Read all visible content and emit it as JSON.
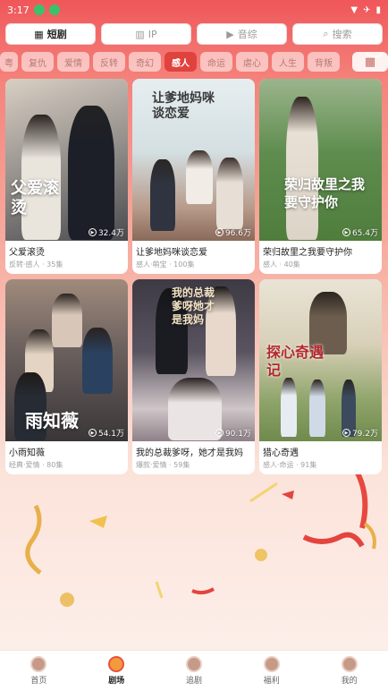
{
  "status_bar": {
    "time": "3:17"
  },
  "top_tabs": [
    {
      "label": "短剧",
      "icon": "grid-icon",
      "active": true
    },
    {
      "label": "IP",
      "icon": "bar-chart-icon",
      "active": false
    },
    {
      "label": "音综",
      "icon": "play-box-icon",
      "active": false
    },
    {
      "label": "搜索",
      "icon": "search-icon",
      "active": false
    }
  ],
  "categories": [
    "粤",
    "复仇",
    "爱情",
    "反转",
    "奇幻",
    "感人",
    "命运",
    "虐心",
    "人生",
    "背叛"
  ],
  "active_category": "感人",
  "dramas": [
    {
      "title": "父爱滚烫",
      "meta": "反转·感人 · 35集",
      "views": "32.4万",
      "poster_text": "父爱滚烫"
    },
    {
      "title": "让爹地妈咪谈恋爱",
      "meta": "感人·萌宝 · 100集",
      "views": "96.6万",
      "poster_text": "让爹地妈咪谈恋爱"
    },
    {
      "title": "荣归故里之我要守护你",
      "meta": "感人 · 40集",
      "views": "65.4万",
      "poster_text": "荣归故里之我要守护你"
    },
    {
      "title": "小雨知薇",
      "meta": "经典·爱情 · 80集",
      "views": "54.1万",
      "poster_text": "雨知薇"
    },
    {
      "title": "我的总裁爹呀，她才是我妈",
      "meta": "爆款·爱情 · 59集",
      "views": "90.1万",
      "poster_text": "我的总裁爹呀她才是我妈"
    },
    {
      "title": "猎心奇遇",
      "meta": "感人·命运 · 91集",
      "views": "79.2万",
      "poster_text": "探心奇遇记"
    }
  ],
  "bottom_nav": [
    {
      "label": "首页",
      "active": false
    },
    {
      "label": "剧场",
      "active": true
    },
    {
      "label": "追剧",
      "active": false
    },
    {
      "label": "福利",
      "active": false
    },
    {
      "label": "我的",
      "active": false
    }
  ]
}
